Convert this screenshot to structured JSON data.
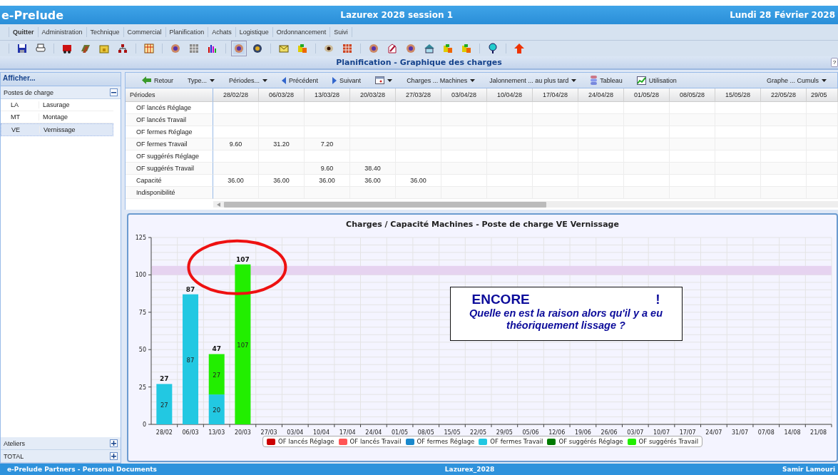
{
  "window": {
    "app": "e-Prelude",
    "title": "Lazurex 2028 session 1",
    "date": "Lundi 28 Février 2028"
  },
  "menu": [
    "Quitter",
    "Administration",
    "Technique",
    "Commercial",
    "Planification",
    "Achats",
    "Logistique",
    "Ordonnancement",
    "Suivi"
  ],
  "page_title": "Planification - Graphique des charges",
  "help": "?",
  "sidebar": {
    "header": "Afficher...",
    "section": "Postes de charge",
    "section_expanded": true,
    "items": [
      {
        "code": "LA",
        "name": "Lasurage",
        "selected": false
      },
      {
        "code": "MT",
        "name": "Montage",
        "selected": false
      },
      {
        "code": "VE",
        "name": "Vernissage",
        "selected": true
      }
    ],
    "groups": [
      {
        "label": "Ateliers",
        "expanded": false
      },
      {
        "label": "TOTAL",
        "expanded": false
      }
    ]
  },
  "toolbar": [
    {
      "kind": "back",
      "label": "Retour"
    },
    {
      "kind": "menu",
      "label": "Type..."
    },
    {
      "kind": "menu",
      "label": "Périodes..."
    },
    {
      "kind": "prev",
      "label": "Précédent"
    },
    {
      "kind": "next",
      "label": "Suivant"
    },
    {
      "kind": "calendar"
    },
    {
      "kind": "menu",
      "label": "Charges ... Machines"
    },
    {
      "kind": "menu",
      "label": "Jalonnement ... au plus tard"
    },
    {
      "kind": "table",
      "label": "Tableau"
    },
    {
      "kind": "chart",
      "label": "Utilisation"
    },
    {
      "kind": "spacer"
    },
    {
      "kind": "menu",
      "label": "Graphe ... Cumuls"
    }
  ],
  "table": {
    "columns": [
      "Périodes",
      "28/02/28",
      "06/03/28",
      "13/03/28",
      "20/03/28",
      "27/03/28",
      "03/04/28",
      "10/04/28",
      "17/04/28",
      "24/04/28",
      "01/05/28",
      "08/05/28",
      "15/05/28",
      "22/05/28",
      "29/05"
    ],
    "rows": [
      [
        "OF lancés Réglage",
        "",
        "",
        "",
        "",
        "",
        "",
        "",
        "",
        "",
        "",
        "",
        "",
        "",
        ""
      ],
      [
        "OF lancés Travail",
        "",
        "",
        "",
        "",
        "",
        "",
        "",
        "",
        "",
        "",
        "",
        "",
        "",
        ""
      ],
      [
        "OF fermes Réglage",
        "",
        "",
        "",
        "",
        "",
        "",
        "",
        "",
        "",
        "",
        "",
        "",
        "",
        ""
      ],
      [
        "OF fermes Travail",
        "9.60",
        "31.20",
        "7.20",
        "",
        "",
        "",
        "",
        "",
        "",
        "",
        "",
        "",
        "",
        ""
      ],
      [
        "OF suggérés Réglage",
        "",
        "",
        "",
        "",
        "",
        "",
        "",
        "",
        "",
        "",
        "",
        "",
        "",
        ""
      ],
      [
        "OF suggérés Travail",
        "",
        "",
        "9.60",
        "38.40",
        "",
        "",
        "",
        "",
        "",
        "",
        "",
        "",
        "",
        ""
      ],
      [
        "Capacité",
        "36.00",
        "36.00",
        "36.00",
        "36.00",
        "36.00",
        "",
        "",
        "",
        "",
        "",
        "",
        "",
        "",
        ""
      ],
      [
        "Indisponibilité",
        "",
        "",
        "",
        "",
        "",
        "",
        "",
        "",
        "",
        "",
        "",
        "",
        "",
        ""
      ]
    ]
  },
  "chart": {
    "chart_data": {
      "type": "bar",
      "stacked": true,
      "grid": true,
      "title": "Charges / Capacité Machines - Poste de charge VE Vernissage",
      "categories": [
        "28/02",
        "06/03",
        "13/03",
        "20/03",
        "27/03",
        "03/04",
        "10/04",
        "17/04",
        "24/04",
        "01/05",
        "08/05",
        "15/05",
        "22/05",
        "29/05",
        "05/06",
        "12/06",
        "19/06",
        "26/06",
        "03/07",
        "10/07",
        "17/07",
        "24/07",
        "31/07",
        "07/08",
        "14/08",
        "21/08"
      ],
      "ylim": [
        0,
        125
      ],
      "yticks": [
        0,
        25,
        50,
        75,
        100,
        125
      ],
      "series": [
        {
          "name": "OF lancés Réglage",
          "color": "#cc0000",
          "values": [
            0,
            0,
            0,
            0,
            0,
            0,
            0,
            0,
            0,
            0,
            0,
            0,
            0,
            0,
            0,
            0,
            0,
            0,
            0,
            0,
            0,
            0,
            0,
            0,
            0,
            0
          ]
        },
        {
          "name": "OF lancés Travail",
          "color": "#ff5555",
          "values": [
            0,
            0,
            0,
            0,
            0,
            0,
            0,
            0,
            0,
            0,
            0,
            0,
            0,
            0,
            0,
            0,
            0,
            0,
            0,
            0,
            0,
            0,
            0,
            0,
            0,
            0
          ]
        },
        {
          "name": "OF fermes Réglage",
          "color": "#1a88cc",
          "values": [
            0,
            0,
            0,
            0,
            0,
            0,
            0,
            0,
            0,
            0,
            0,
            0,
            0,
            0,
            0,
            0,
            0,
            0,
            0,
            0,
            0,
            0,
            0,
            0,
            0,
            0
          ]
        },
        {
          "name": "OF fermes Travail",
          "color": "#22c8e2",
          "values": [
            27,
            87,
            20,
            0,
            0,
            0,
            0,
            0,
            0,
            0,
            0,
            0,
            0,
            0,
            0,
            0,
            0,
            0,
            0,
            0,
            0,
            0,
            0,
            0,
            0,
            0
          ],
          "value_labels": [
            "27",
            "87",
            "20",
            null,
            null,
            null,
            null,
            null,
            null,
            null,
            null,
            null,
            null,
            null,
            null,
            null,
            null,
            null,
            null,
            null,
            null,
            null,
            null,
            null,
            null,
            null
          ]
        },
        {
          "name": "OF suggérés Réglage",
          "color": "#007a00",
          "values": [
            0,
            0,
            0,
            0,
            0,
            0,
            0,
            0,
            0,
            0,
            0,
            0,
            0,
            0,
            0,
            0,
            0,
            0,
            0,
            0,
            0,
            0,
            0,
            0,
            0,
            0
          ]
        },
        {
          "name": "OF suggérés Travail",
          "color": "#22ee00",
          "values": [
            0,
            0,
            27,
            107,
            0,
            0,
            0,
            0,
            0,
            0,
            0,
            0,
            0,
            0,
            0,
            0,
            0,
            0,
            0,
            0,
            0,
            0,
            0,
            0,
            0,
            0
          ],
          "value_labels": [
            null,
            null,
            "27",
            "107",
            null,
            null,
            null,
            null,
            null,
            null,
            null,
            null,
            null,
            null,
            null,
            null,
            null,
            null,
            null,
            null,
            null,
            null,
            null,
            null,
            null,
            null
          ]
        }
      ],
      "bands": [
        {
          "axis": "y",
          "from": 100,
          "to": 106
        }
      ],
      "annotations": [
        {
          "text": "27",
          "x": "28/02",
          "y": 27
        },
        {
          "text": "87",
          "x": "06/03",
          "y": 87
        },
        {
          "text": "47",
          "x": "13/03",
          "y": 47
        },
        {
          "text": "107",
          "x": "20/03",
          "y": 107
        }
      ]
    },
    "callout": {
      "title": "ENCORE",
      "mark": "!",
      "text": "Quelle en est la raison alors qu'il y a eu théoriquement lissage ?"
    }
  },
  "status_bar": {
    "left": "e-Prelude Partners - Personal Documents",
    "center": "Lazurex_2028",
    "right": "Samir Lamouri"
  }
}
